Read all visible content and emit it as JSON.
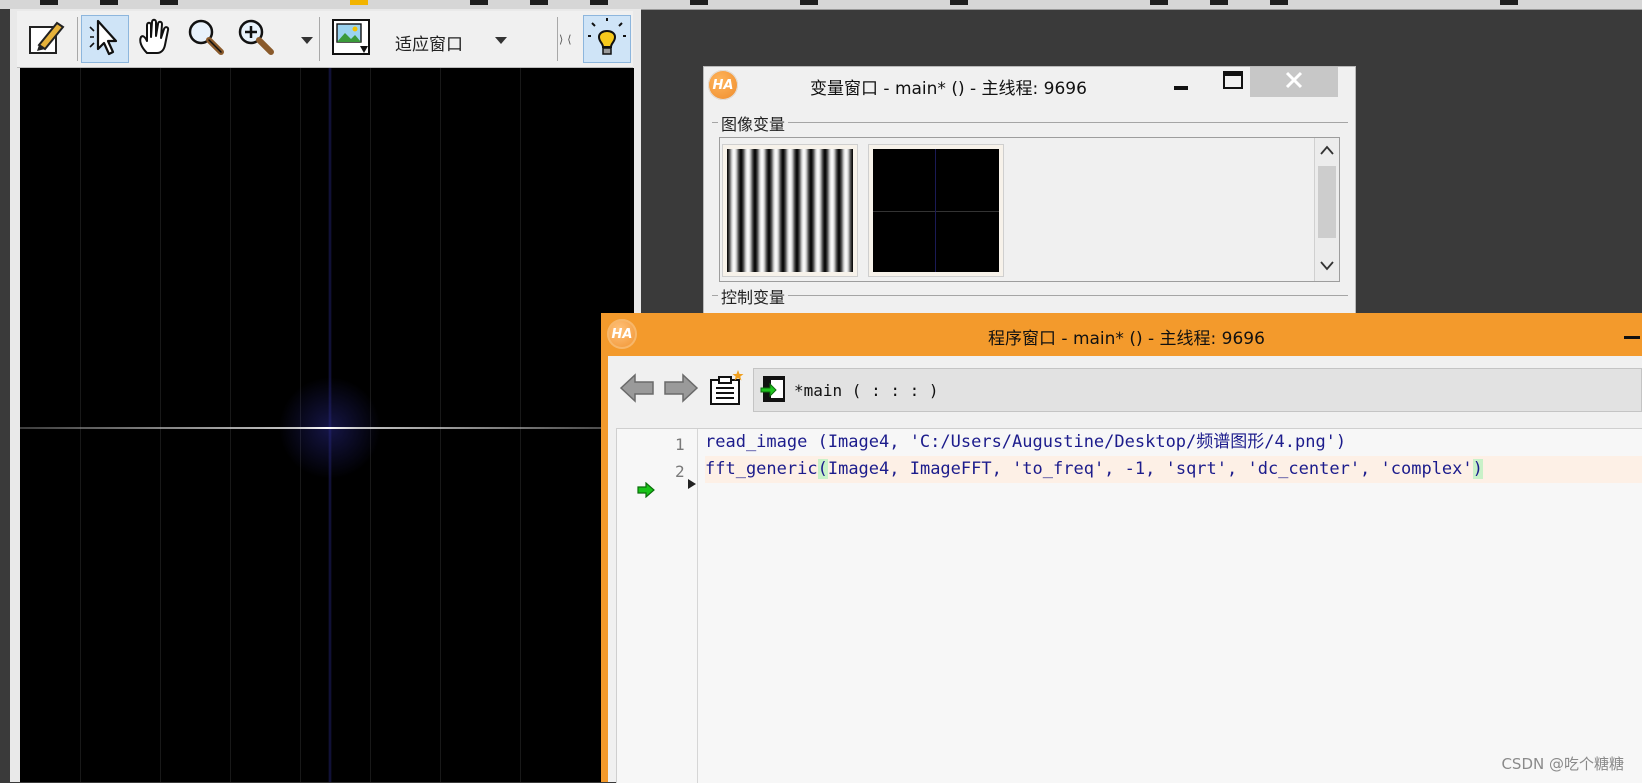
{
  "graphics_window": {
    "zoom_mode": "适应窗口",
    "tools": [
      {
        "name": "set-parameters-icon"
      },
      {
        "name": "pointer-icon"
      },
      {
        "name": "hand-pan-icon"
      },
      {
        "name": "magnifier-icon"
      },
      {
        "name": "zoom-in-icon"
      },
      {
        "name": "fit-image-icon"
      },
      {
        "name": "lightbulb-icon"
      }
    ],
    "mini_controls": "⟩⟨ ⟨⟩"
  },
  "variable_window": {
    "title": "变量窗口 - main* () - 主线程: 9696",
    "iconic_group_label": "图像变量",
    "control_group_label": "控制变量",
    "logo_text": "HA",
    "thumbnails": [
      {
        "kind": "stripes"
      },
      {
        "kind": "fft"
      }
    ]
  },
  "program_window": {
    "title": "程序窗口 - main* () - 主线程: 9696",
    "logo_text": "HA",
    "procedure": "*main ( : : : )",
    "code_lines": [
      {
        "num": "1",
        "text": "read_image (Image4, 'C:/Users/Augustine/Desktop/频谱图形/4.png')"
      },
      {
        "num": "2",
        "pre": "fft_generic",
        "paren_open": "(",
        "mid": "Image4, ImageFFT, 'to_freq', -1, 'sqrt', 'dc_center', 'complex'",
        "paren_close": ")"
      }
    ]
  },
  "watermark": "CSDN @吃个糖糖"
}
